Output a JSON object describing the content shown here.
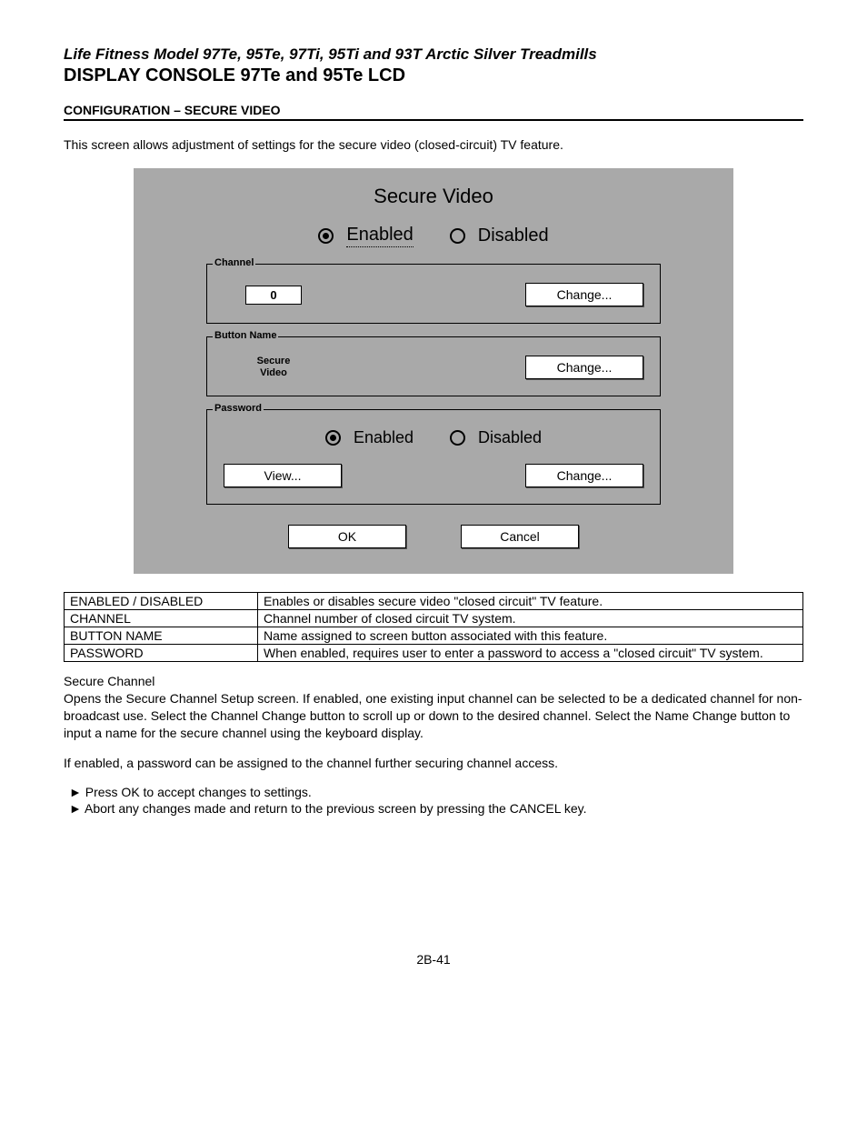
{
  "header": {
    "italic": "Life Fitness Model 97Te, 95Te, 97Ti, 95Ti and 93T Arctic Silver Treadmills",
    "bold": "DISPLAY CONSOLE 97Te and 95Te LCD",
    "section": "CONFIGURATION – SECURE VIDEO",
    "intro": "This screen allows adjustment of settings for the secure video (closed-circuit) TV feature."
  },
  "dialog": {
    "title": "Secure Video",
    "enabled_label": "Enabled",
    "disabled_label": "Disabled",
    "channel": {
      "legend": "Channel",
      "value": "0",
      "change": "Change..."
    },
    "button_name": {
      "legend": "Button Name",
      "value": "Secure\nVideo",
      "change": "Change..."
    },
    "password": {
      "legend": "Password",
      "enabled_label": "Enabled",
      "disabled_label": "Disabled",
      "view": "View...",
      "change": "Change..."
    },
    "ok": "OK",
    "cancel": "Cancel"
  },
  "table": {
    "r1k": "ENABLED / DISABLED",
    "r1v": "Enables or disables secure video \"closed circuit\" TV feature.",
    "r2k": "CHANNEL",
    "r2v": "Channel number of closed circuit TV system.",
    "r3k": "BUTTON NAME",
    "r3v": "Name assigned to screen button associated with this feature.",
    "r4k": "PASSWORD",
    "r4v": "When enabled, requires user to enter a password to access a \"closed circuit\" TV system."
  },
  "body": {
    "h": "Secure Channel",
    "p1": "Opens the Secure Channel Setup screen. If enabled, one existing input channel can be selected to be a dedicated channel for non-broadcast use. Select the Channel Change button to scroll up or down to the desired channel. Select the Name Change button to input a name for the secure channel using the keyboard display.",
    "p2": "If enabled, a password can be assigned to the channel further securing channel access.",
    "b1": "Press OK to accept changes to settings.",
    "b2": "Abort any changes made and return to the previous screen by pressing the CANCEL key."
  },
  "page": "2B-41"
}
